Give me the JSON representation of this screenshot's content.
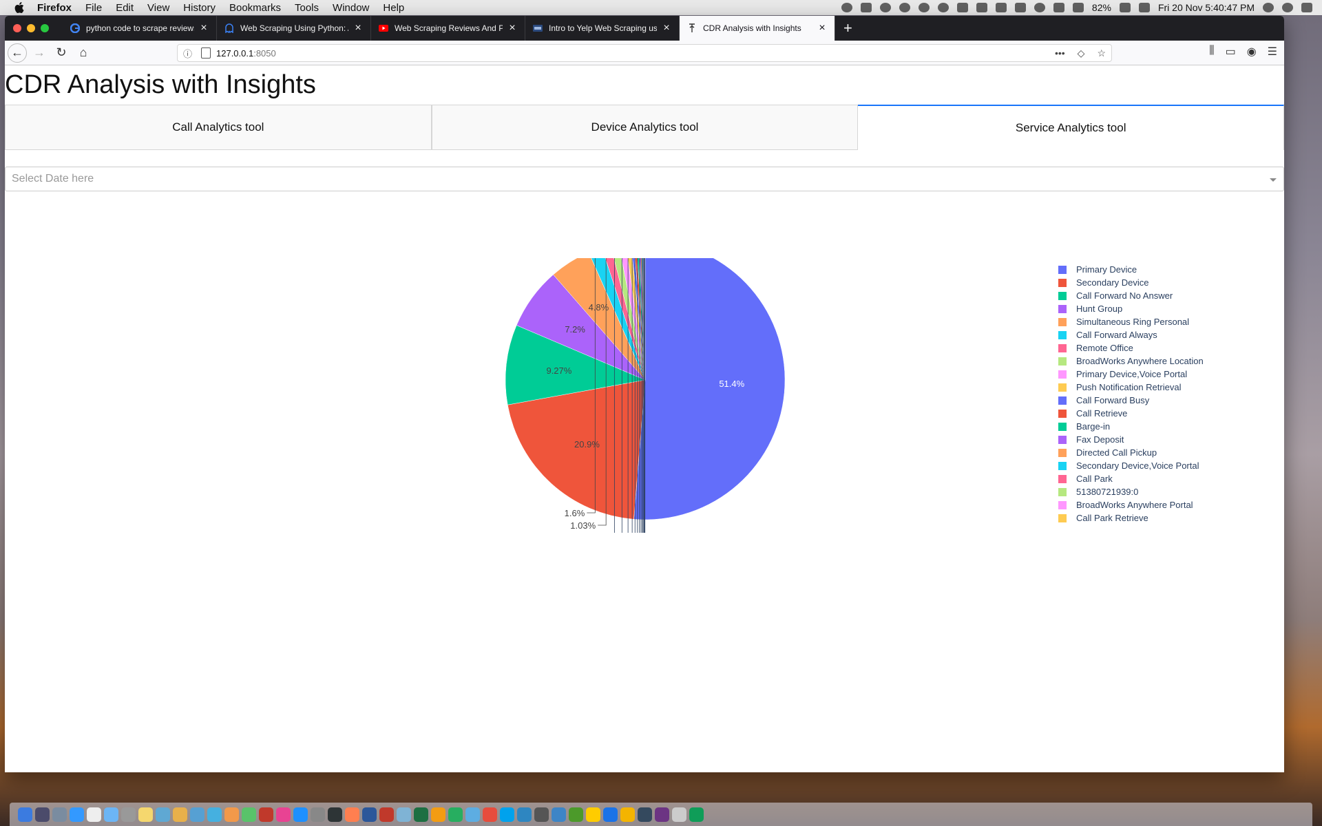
{
  "menubar": {
    "app_name": "Firefox",
    "items": [
      "File",
      "Edit",
      "View",
      "History",
      "Bookmarks",
      "Tools",
      "Window",
      "Help"
    ],
    "battery": "82%",
    "clock": "Fri 20 Nov  5:40:47 PM"
  },
  "browser": {
    "tabs": [
      {
        "title": "python code to scrape reviews",
        "icon": "google-icon"
      },
      {
        "title": "Web Scraping Using Python: A",
        "icon": "ghost-icon"
      },
      {
        "title": "Web Scraping Reviews And Pro",
        "icon": "youtube-icon"
      },
      {
        "title": "Intro to Yelp Web Scraping usi",
        "icon": "site-icon"
      },
      {
        "title": "CDR Analysis with Insights",
        "icon": "page-icon",
        "active": true
      }
    ],
    "url_host": "127.0.0.1",
    "url_port": ":8050"
  },
  "page": {
    "title": "CDR Analysis with Insights",
    "tabs": [
      "Call Analytics tool",
      "Device Analytics tool",
      "Service Analytics tool"
    ],
    "selected_tab": "Service Analytics tool",
    "date_dropdown": {
      "placeholder": "Select Date here"
    }
  },
  "chart_data": {
    "type": "pie",
    "title": "",
    "labels": [
      "Primary Device",
      "Secondary Device",
      "Call Forward No Answer",
      "Hunt Group",
      "Simultaneous Ring Personal",
      "Call Forward Always",
      "Remote Office",
      "BroadWorks Anywhere Location",
      "Primary Device,Voice Portal",
      "Push Notification Retrieval",
      "Call Forward Busy",
      "Call Retrieve",
      "Barge-in",
      "Fax Deposit",
      "Directed Call Pickup",
      "Secondary Device,Voice Portal",
      "Call Park",
      "51380721939:0",
      "BroadWorks Anywhere Portal",
      "Call Park Retrieve"
    ],
    "values": [
      51.4,
      20.9,
      9.27,
      7.2,
      4.8,
      1.6,
      1.03,
      0.95,
      0.8,
      0.6,
      0.35,
      0.3,
      0.25,
      0.2,
      0.15,
      0.12,
      0.1,
      0.08,
      0.06,
      0.05
    ],
    "display_labels": [
      "51.4%",
      "20.9%",
      "9.27%",
      "7.2%",
      "4.8%",
      "1.6%",
      "1.03%"
    ],
    "colors": [
      "#636efa",
      "#EF553B",
      "#00cc96",
      "#ab63fa",
      "#FFA15A",
      "#19d3f3",
      "#FF6692",
      "#B6E880",
      "#FF97FF",
      "#FECB52",
      "#636efa",
      "#EF553B",
      "#00cc96",
      "#ab63fa",
      "#FFA15A",
      "#19d3f3",
      "#FF6692",
      "#B6E880",
      "#FF97FF",
      "#FECB52"
    ],
    "legend_position": "right"
  },
  "dock": {
    "colors": [
      "#3b7be0",
      "#4b4b6b",
      "#7a8ca0",
      "#3399ff",
      "#eeeeee",
      "#6cb5f5",
      "#999999",
      "#f5d76e",
      "#5fa8d3",
      "#e8b04a",
      "#56a0d3",
      "#45b0e0",
      "#f2994a",
      "#59c36a",
      "#c0392b",
      "#e84393",
      "#1e90ff",
      "#888888",
      "#2d3436",
      "#ff7f50",
      "#2b579a",
      "#c0392b",
      "#7fb3d5",
      "#1d6f42",
      "#f39c12",
      "#27ae60",
      "#5dade2",
      "#e74c3c",
      "#00a2ed",
      "#2e86c1",
      "#555555",
      "#3d85c6",
      "#4c9a2a",
      "#ffcc00",
      "#1a73e8",
      "#f4b400",
      "#34495e",
      "#6c3483",
      "#cccccc",
      "#0f9d58"
    ]
  }
}
